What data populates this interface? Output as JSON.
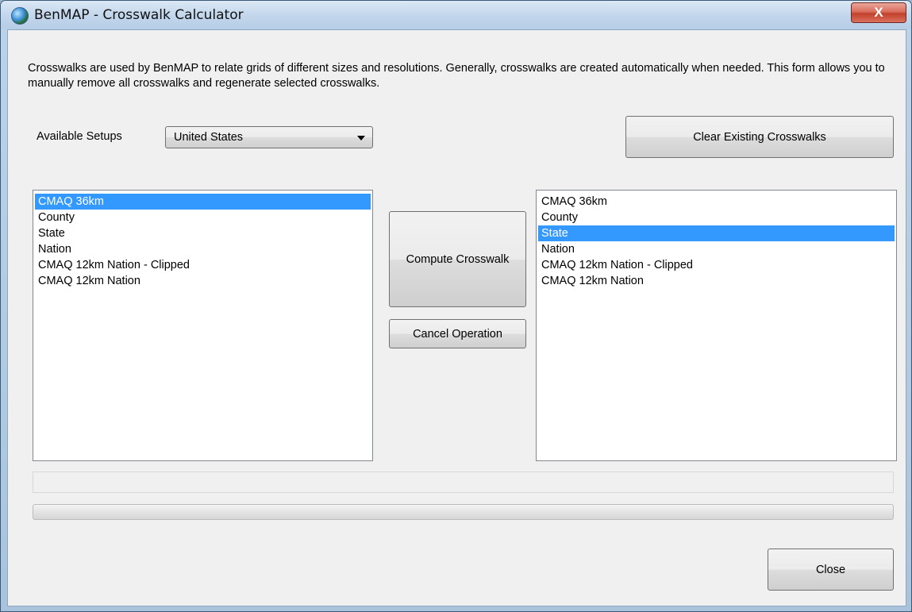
{
  "window": {
    "title": "BenMAP - Crosswalk Calculator",
    "close_glyph": "X"
  },
  "description": "Crosswalks are used by BenMAP to relate grids of different sizes and resolutions. Generally, crosswalks are created automatically when needed. This form allows you to manually remove all crosswalks and regenerate selected crosswalks.",
  "setups": {
    "label": "Available Setups",
    "selected": "United States"
  },
  "buttons": {
    "clear": "Clear Existing Crosswalks",
    "compute": "Compute Crosswalk",
    "cancel": "Cancel Operation",
    "close": "Close"
  },
  "left_grids": [
    {
      "label": "CMAQ 36km",
      "selected": true
    },
    {
      "label": "County",
      "selected": false
    },
    {
      "label": "State",
      "selected": false
    },
    {
      "label": "Nation",
      "selected": false
    },
    {
      "label": "CMAQ 12km Nation - Clipped",
      "selected": false
    },
    {
      "label": "CMAQ 12km Nation",
      "selected": false
    }
  ],
  "right_grids": [
    {
      "label": "CMAQ 36km",
      "selected": false
    },
    {
      "label": "County",
      "selected": false
    },
    {
      "label": "State",
      "selected": true
    },
    {
      "label": "Nation",
      "selected": false
    },
    {
      "label": "CMAQ 12km Nation - Clipped",
      "selected": false
    },
    {
      "label": "CMAQ 12km Nation",
      "selected": false
    }
  ],
  "status_text": "",
  "progress": 0,
  "colors": {
    "selection": "#3399ff",
    "close_button": "#c2412c"
  },
  "icons": {
    "app": "benmap-globe-icon",
    "close": "close-icon",
    "dropdown": "chevron-down-icon"
  }
}
